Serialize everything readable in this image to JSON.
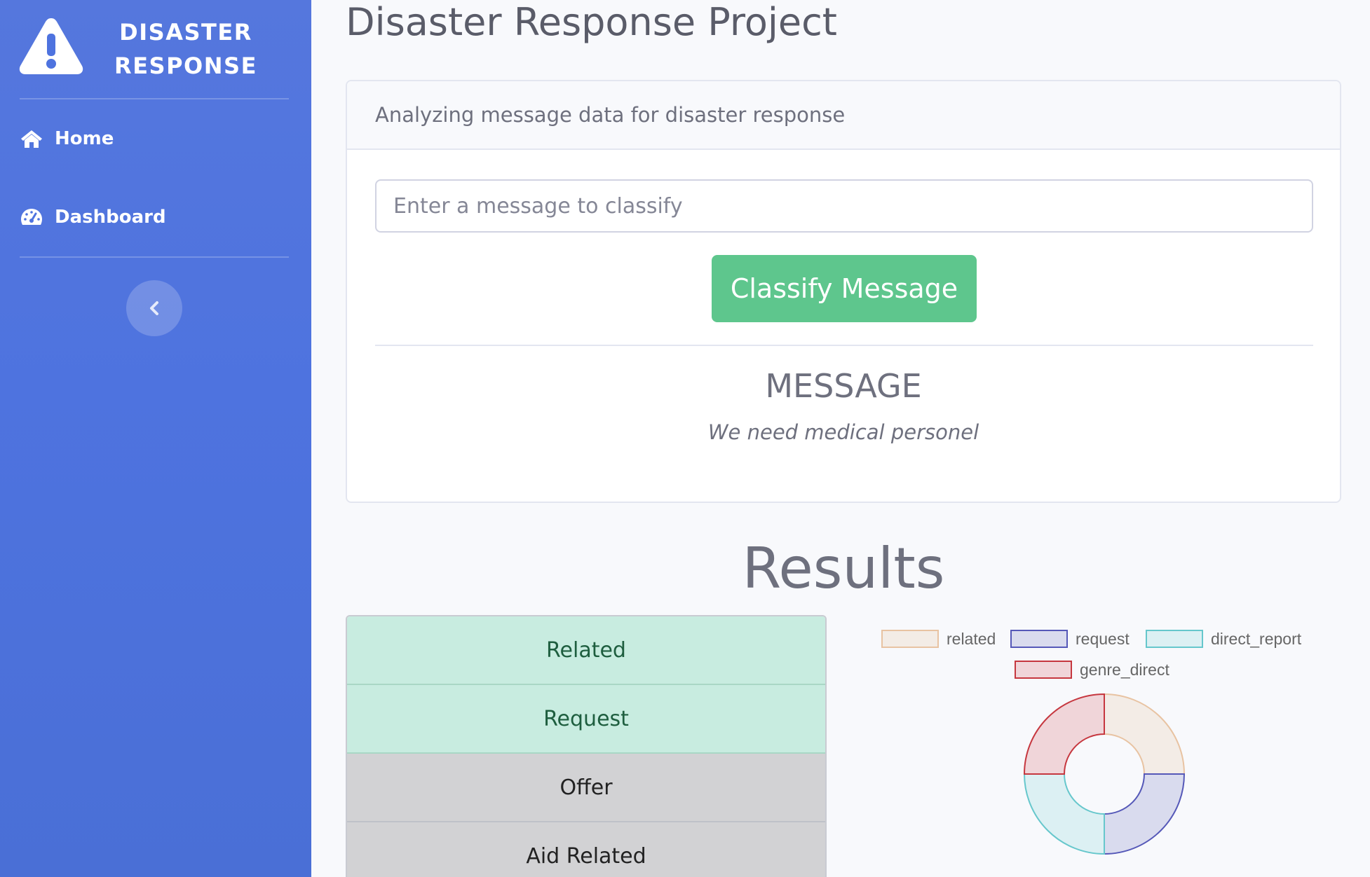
{
  "sidebar": {
    "brand_line1": "DISASTER",
    "brand_line2": "RESPONSE",
    "brand_icon": "warning-icon",
    "items": [
      {
        "label": "Home",
        "icon": "home-icon"
      },
      {
        "label": "Dashboard",
        "icon": "tachometer-icon"
      }
    ],
    "toggle_icon": "chevron-left-icon"
  },
  "page_title": "Disaster Response Project",
  "card": {
    "header": "Analyzing message data for disaster response",
    "input_placeholder": "Enter a message to classify",
    "button_label": "Classify Message",
    "message_heading": "MESSAGE",
    "message_text": "We need medical personel"
  },
  "results_title": "Results",
  "categories": [
    {
      "label": "Related",
      "status": "positive"
    },
    {
      "label": "Request",
      "status": "positive"
    },
    {
      "label": "Offer",
      "status": "negative"
    },
    {
      "label": "Aid Related",
      "status": "negative"
    }
  ],
  "colors": {
    "sidebar": "#4e73df",
    "button": "#5ec68d",
    "positive_bg": "#c8ece0",
    "negative_bg": "#d2d2d4"
  },
  "chart_data": {
    "type": "pie",
    "style": "doughnut",
    "title": "",
    "legend_position": "top",
    "labels": [
      "related",
      "request",
      "direct_report",
      "genre_direct"
    ],
    "values": [
      1,
      1,
      1,
      1
    ],
    "fill_colors": [
      "#f3ece6",
      "#d9dbee",
      "#dcf0f3",
      "#f0d5d9"
    ],
    "border_colors": [
      "#e8c3a2",
      "#5558b8",
      "#66c7cc",
      "#c6373f"
    ]
  }
}
